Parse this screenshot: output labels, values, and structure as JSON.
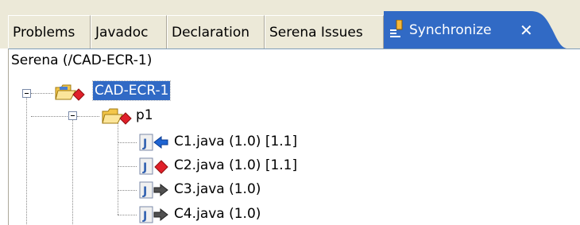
{
  "tabs": [
    {
      "label": "Problems"
    },
    {
      "label": "Javadoc"
    },
    {
      "label": "Declaration"
    },
    {
      "label": "Serena Issues"
    },
    {
      "label": "Synchronize",
      "active": true,
      "close_glyph": "✕"
    }
  ],
  "context_label": "Serena (/CAD-ECR-1)",
  "tree": {
    "root": {
      "label": "CAD-ECR-1",
      "icon": "project-conflict-folder-icon",
      "selected": true
    },
    "folder": {
      "label": "p1",
      "icon": "package-conflict-folder-icon"
    },
    "files": [
      {
        "label": "C1.java (1.0) [1.1]",
        "icon": "incoming-change-java-icon"
      },
      {
        "label": "C2.java (1.0) [1.1]",
        "icon": "conflict-java-icon"
      },
      {
        "label": "C3.java (1.0)",
        "icon": "outgoing-change-java-icon"
      },
      {
        "label": "C4.java (1.0)",
        "icon": "outgoing-change-java-icon"
      }
    ]
  },
  "colors": {
    "active_tab": "#316ac5",
    "selection": "#316ac5",
    "conflict": "#e0202a",
    "incoming": "#1e64d2",
    "outgoing": "#505050",
    "folder": "#f3c64a"
  }
}
